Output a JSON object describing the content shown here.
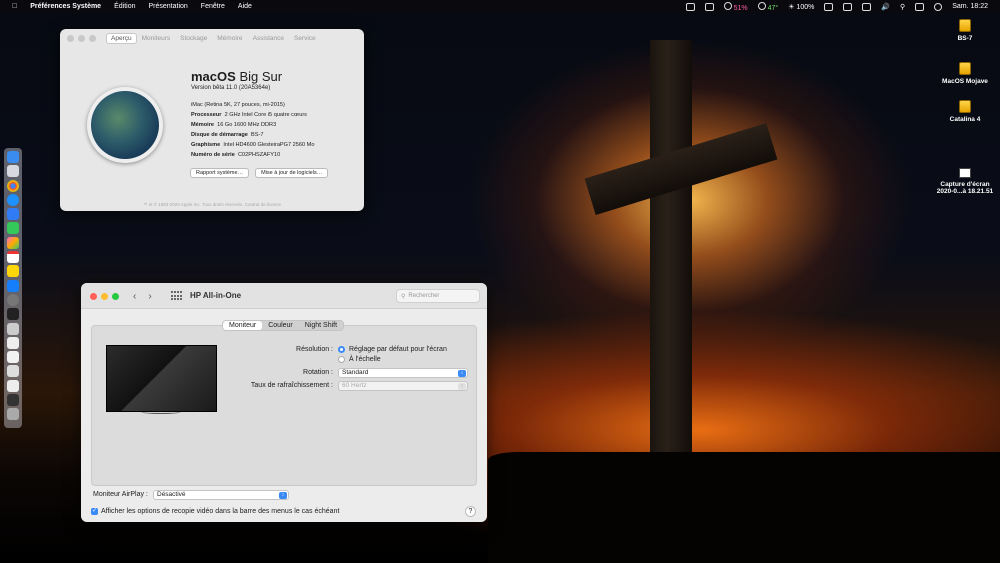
{
  "menubar": {
    "app_name": "Préférences Système",
    "menus": [
      "Édition",
      "Présentation",
      "Fenêtre",
      "Aide"
    ],
    "battery_percent": "51%",
    "temperature": "47°",
    "brightness": "100%",
    "datetime": "Sam. 18:22"
  },
  "desktop": {
    "icons": [
      {
        "label": "BS-7"
      },
      {
        "label": "MacOS Mojave"
      },
      {
        "label": "Catalina 4"
      },
      {
        "label_line1": "Capture d'écran",
        "label_line2": "2020-0...à 18.21.51"
      }
    ]
  },
  "about_window": {
    "tabs": [
      "Aperçu",
      "Moniteurs",
      "Stockage",
      "Mémoire",
      "Assistance",
      "Service"
    ],
    "os_name_bold": "macOS",
    "os_name_rest": "Big Sur",
    "version": "Version bêta 11.0 (20A5364e)",
    "model": "iMac (Retina 5K, 27 pouces, mi-2015)",
    "specs": [
      {
        "label": "Processeur",
        "value": "2 GHz Intel Core i5 quatre cœurs"
      },
      {
        "label": "Mémoire",
        "value": "16 Go 1600 MHz DDR3"
      },
      {
        "label": "Disque de démarrage",
        "value": "BS-7"
      },
      {
        "label": "Graphisme",
        "value": "Intel HD4600 GlesteiraPG7 2560 Mo"
      },
      {
        "label": "Numéro de série",
        "value": "C02PHSZAFY10"
      }
    ],
    "button_report": "Rapport système…",
    "button_update": "Mise à jour de logiciels…",
    "legal": "™ et © 1983-2020 Apple Inc. Tous droits réservés. Contrat de licence"
  },
  "display_window": {
    "title": "HP All-in-One",
    "search_placeholder": "Rechercher",
    "tabs": [
      "Moniteur",
      "Couleur",
      "Night Shift"
    ],
    "resolution_label": "Résolution :",
    "resolution_option_default": "Réglage par défaut pour l'écran",
    "resolution_option_scaled": "À l'échelle",
    "rotation_label": "Rotation :",
    "rotation_value": "Standard",
    "refresh_label": "Taux de rafraîchissement :",
    "refresh_value": "60 Hertz",
    "airplay_label": "Moniteur AirPlay :",
    "airplay_value": "Désactivé",
    "mirror_checkbox": "Afficher les options de recopie vidéo dans la barre des menus le cas échéant",
    "help": "?"
  },
  "colors": {
    "accent": "#3a8af5",
    "close": "#ff5f57",
    "minimize": "#febc2e",
    "zoom": "#28c840"
  }
}
